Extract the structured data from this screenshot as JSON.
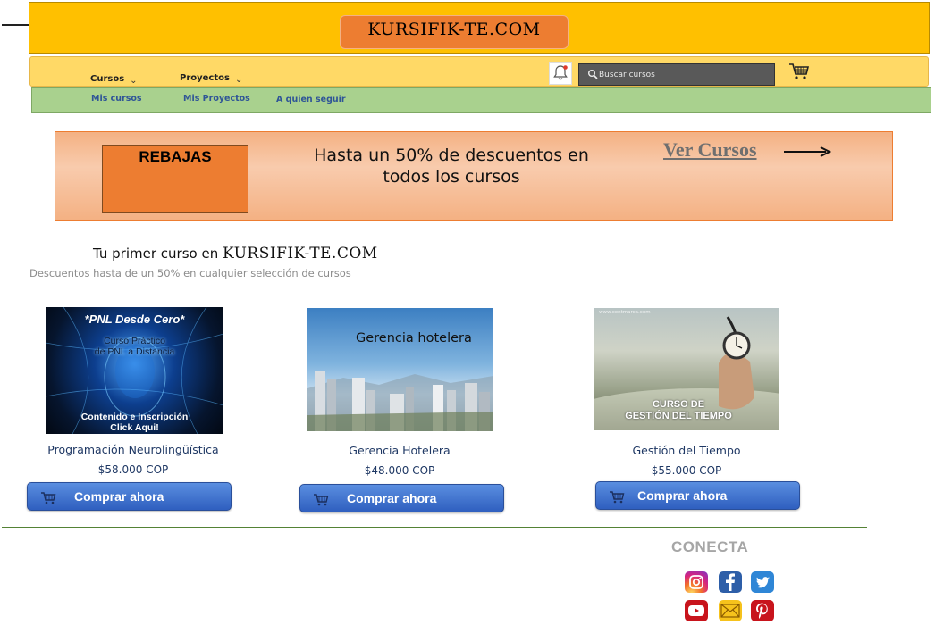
{
  "header": {
    "brand": "KURSIFIK-TE.COM"
  },
  "nav": {
    "cursos": "Cursos",
    "proyectos": "Proyectos",
    "search_placeholder": "Buscar cursos",
    "icons": [
      "bell-icon",
      "cart-icon",
      "search-icon",
      "chevron-down-icon"
    ]
  },
  "subnav": {
    "mis_cursos": "Mis cursos",
    "mis_proyectos": "Mis Proyectos",
    "a_quien_seguir": "A quien seguir"
  },
  "banner": {
    "sale_label": "REBAJAS",
    "promo_line1": "Hasta un 50% de descuentos en",
    "promo_line2": "todos los cursos",
    "cta": "Ver Cursos"
  },
  "intro": {
    "title_prefix": "Tu primer curso en",
    "title_brand": "KURSIFIK-TE.COM",
    "subtitle": "Descuentos hasta de un 50% en cualquier selección de cursos"
  },
  "courses": [
    {
      "name": "Programación Neurolingüística",
      "price": "$58.000 COP",
      "button": "Comprar ahora",
      "image_text": {
        "top": "*PNL Desde Cero*",
        "mid1": "Curso Práctico",
        "mid2": "de PNL a Distancia",
        "bottom1": "Contenido e Inscripción",
        "bottom2": "Click Aqui!"
      }
    },
    {
      "name": "Gerencia Hotelera",
      "price": "$48.000 COP",
      "button": "Comprar ahora",
      "image_text": {
        "title": "Gerencia hotelera"
      }
    },
    {
      "name": "Gestión del Tiempo",
      "price": "$55.000 COP",
      "button": "Comprar ahora",
      "image_text": {
        "small": "www.centmarca.com",
        "line1": "CURSO DE",
        "line2": "GESTIÓN DEL TIEMPO"
      }
    }
  ],
  "footer": {
    "conecta": "CONECTA",
    "social": [
      "instagram-icon",
      "facebook-icon",
      "twitter-icon",
      "youtube-icon",
      "email-icon",
      "pinterest-icon"
    ]
  },
  "colors": {
    "header": "#ffc000",
    "brand_box": "#ed7d31",
    "navbar": "#ffd966",
    "subnav": "#a9d18e",
    "banner": "#f4b183",
    "button": "#3a6fd0",
    "link_text": "#2f5597"
  }
}
